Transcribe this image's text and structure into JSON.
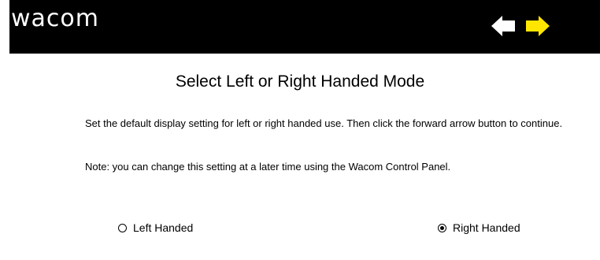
{
  "header": {
    "logo_text": "wacom",
    "background": "#000000",
    "back_icon": "left-arrow-icon",
    "back_color": "#ffffff",
    "forward_icon": "right-arrow-icon",
    "forward_color": "#ffe600"
  },
  "main": {
    "title": "Select Left or Right Handed Mode",
    "instructions": "Set the default display setting for left or right handed use. Then click the forward arrow button to continue.",
    "note": "Note: you can change this setting at a later time using the Wacom Control Panel."
  },
  "options": [
    {
      "label": "Left Handed",
      "selected": false
    },
    {
      "label": "Right Handed",
      "selected": true
    }
  ]
}
